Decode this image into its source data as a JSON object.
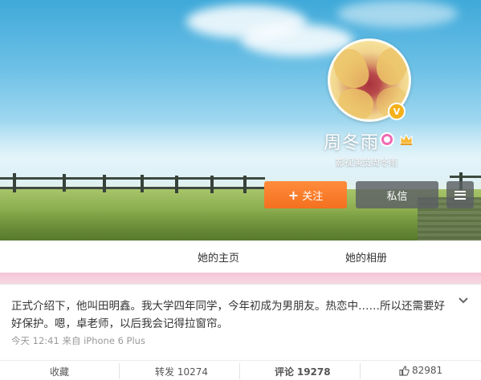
{
  "profile": {
    "name": "周冬雨",
    "subtitle": "影视演员周冬雨",
    "verified_mark": "V"
  },
  "buttons": {
    "follow_plus": "+",
    "follow_label": "关注",
    "message_label": "私信"
  },
  "tabs": [
    {
      "label": "她的主页"
    },
    {
      "label": "她的相册"
    }
  ],
  "post": {
    "text": "正式介绍下，他叫田明鑫。我大学四年同学，今年初成为男朋友。热恋中……所以还需要好好保护。嗯，卓老师，以后我会记得拉窗帘。",
    "meta": "今天 12:41 来自 iPhone 6 Plus",
    "actions": {
      "favorite": "收藏",
      "repost_label": "转发",
      "repost_count": "10274",
      "comment_label": "评论",
      "comment_count": "19278",
      "like_count": "82981"
    }
  },
  "icons": {
    "verified": "verified-v-icon",
    "vip": "vip-icon",
    "crown": "crown-icon",
    "more": "menu-icon",
    "expand": "chevron-down-icon",
    "like": "thumbs-up-icon"
  },
  "colors": {
    "follow_button": "#f3701f",
    "verified_badge": "#f4b11a",
    "vip_badge": "#f06ab3",
    "band": "#f4c6d7"
  }
}
